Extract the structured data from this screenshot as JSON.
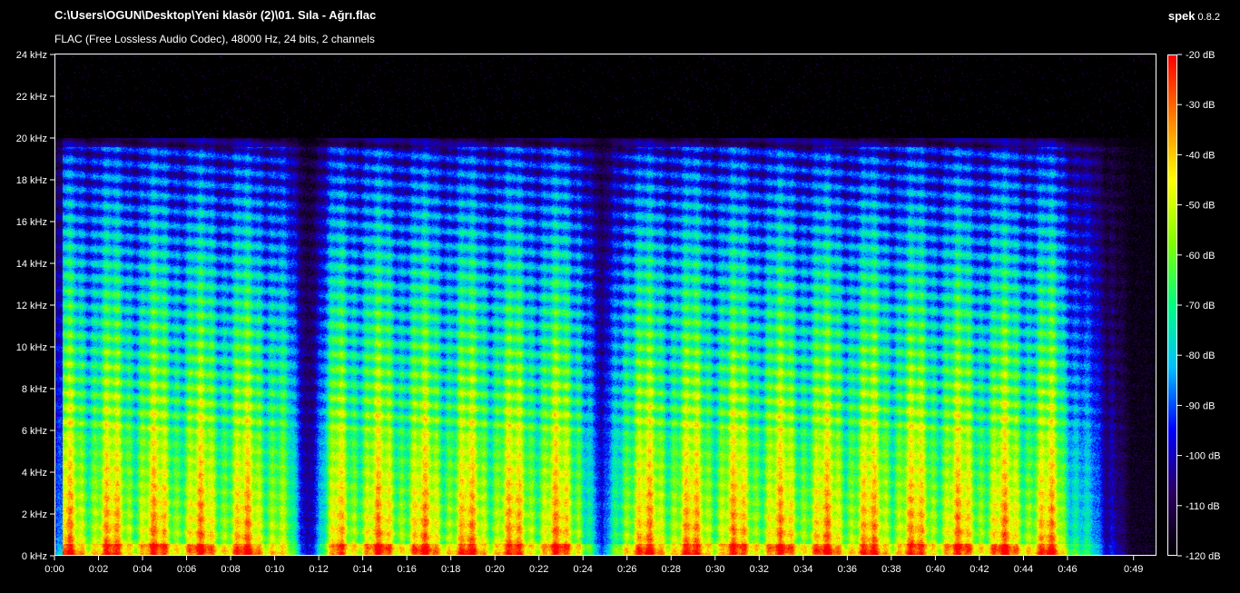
{
  "header": {
    "title": "C:\\Users\\OGUN\\Desktop\\Yeni klasör (2)\\01. Sıla - Ağrı.flac",
    "subtitle": "FLAC (Free Lossless Audio Codec), 48000 Hz, 24 bits, 2 channels",
    "app_name": "spek",
    "app_version": "0.8.2"
  },
  "chart_data": {
    "type": "heatmap",
    "title": "C:\\Users\\OGUN\\Desktop\\Yeni klasör (2)\\01. Sıla - Ağrı.flac",
    "subtitle": "FLAC (Free Lossless Audio Codec), 48000 Hz, 24 bits, 2 channels",
    "xlabel": "",
    "ylabel": "",
    "x_range_seconds": [
      0,
      50
    ],
    "y_range_khz": [
      0,
      24
    ],
    "x_ticks": [
      "0:00",
      "0:02",
      "0:04",
      "0:06",
      "0:08",
      "0:10",
      "0:12",
      "0:14",
      "0:16",
      "0:18",
      "0:20",
      "0:22",
      "0:24",
      "0:26",
      "0:28",
      "0:30",
      "0:32",
      "0:34",
      "0:36",
      "0:38",
      "0:40",
      "0:42",
      "0:44",
      "0:46",
      "0:49"
    ],
    "x_tick_seconds": [
      0,
      2,
      4,
      6,
      8,
      10,
      12,
      14,
      16,
      18,
      20,
      22,
      24,
      26,
      28,
      30,
      32,
      34,
      36,
      38,
      40,
      42,
      44,
      46,
      49
    ],
    "y_ticks": [
      "0 kHz",
      "2 kHz",
      "4 kHz",
      "6 kHz",
      "8 kHz",
      "10 kHz",
      "12 kHz",
      "14 kHz",
      "16 kHz",
      "18 kHz",
      "20 kHz",
      "22 kHz",
      "24 kHz"
    ],
    "y_tick_khz": [
      0,
      2,
      4,
      6,
      8,
      10,
      12,
      14,
      16,
      18,
      20,
      22,
      24
    ],
    "colorbar": {
      "ticks": [
        "-20 dB",
        "-30 dB",
        "-40 dB",
        "-50 dB",
        "-60 dB",
        "-70 dB",
        "-80 dB",
        "-90 dB",
        "-100 dB",
        "-110 dB",
        "-120 dB"
      ],
      "tick_db": [
        -20,
        -30,
        -40,
        -50,
        -60,
        -70,
        -80,
        -90,
        -100,
        -110,
        -120
      ],
      "range_db": [
        -120,
        -20
      ],
      "colors": [
        "#000000",
        "#2a0060",
        "#0000ff",
        "#00c0ff",
        "#00ff80",
        "#80ff00",
        "#ffff00",
        "#ff8000",
        "#ff0000"
      ]
    },
    "cutoff_khz": 20,
    "quiet_regions_seconds": [
      [
        10.6,
        12.2
      ],
      [
        24.4,
        25.2
      ],
      [
        46.0,
        49.5
      ]
    ],
    "grid": false
  }
}
